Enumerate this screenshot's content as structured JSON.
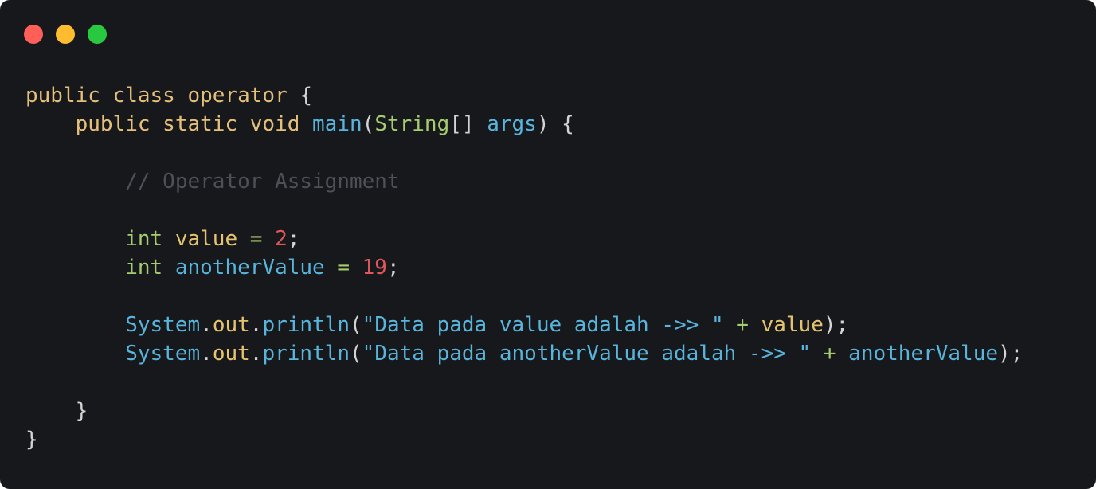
{
  "window": {
    "traffic_lights": [
      {
        "name": "close-dot",
        "color": "#ff5f57"
      },
      {
        "name": "minimize-dot",
        "color": "#febc2e"
      },
      {
        "name": "zoom-dot",
        "color": "#28c840"
      }
    ]
  },
  "colors": {
    "keyword": "#e5c07b",
    "function": "#61afef",
    "type": "#98c379",
    "string": "#56b6c2",
    "number": "#e06c75",
    "comment": "#5c6370",
    "punctuation": "#d4d4d4",
    "variable_yellow": "#e5c07b",
    "variable_blue": "#61afef"
  },
  "code": {
    "lines": [
      [
        {
          "t": "public class operator ",
          "c": "#e5c07b"
        },
        {
          "t": "{",
          "c": "#d4d4d4"
        }
      ],
      [
        {
          "t": "    public static void ",
          "c": "#e5c07b"
        },
        {
          "t": "main",
          "c": "#58b5dd"
        },
        {
          "t": "(",
          "c": "#d4d4d4"
        },
        {
          "t": "String",
          "c": "#a6cc70"
        },
        {
          "t": "[] ",
          "c": "#d4d4d4"
        },
        {
          "t": "args",
          "c": "#58b5dd"
        },
        {
          "t": ") {",
          "c": "#d4d4d4"
        }
      ],
      [],
      [
        {
          "t": "        // Operator Assignment",
          "c": "#4c5158"
        }
      ],
      [],
      [
        {
          "t": "        int ",
          "c": "#a6cc70"
        },
        {
          "t": "value",
          "c": "#e6c46f"
        },
        {
          "t": " = ",
          "c": "#a6cc70"
        },
        {
          "t": "2",
          "c": "#e0575b"
        },
        {
          "t": ";",
          "c": "#d4d4d4"
        }
      ],
      [
        {
          "t": "        int ",
          "c": "#a6cc70"
        },
        {
          "t": "anotherValue",
          "c": "#58b5dd"
        },
        {
          "t": " = ",
          "c": "#a6cc70"
        },
        {
          "t": "19",
          "c": "#e0575b"
        },
        {
          "t": ";",
          "c": "#d4d4d4"
        }
      ],
      [],
      [
        {
          "t": "        System",
          "c": "#58b5dd"
        },
        {
          "t": ".",
          "c": "#d4d4d4"
        },
        {
          "t": "out",
          "c": "#e6c46f"
        },
        {
          "t": ".",
          "c": "#d4d4d4"
        },
        {
          "t": "println",
          "c": "#58b5dd"
        },
        {
          "t": "(",
          "c": "#d4d4d4"
        },
        {
          "t": "\"Data pada value adalah ->> \"",
          "c": "#58b5dd"
        },
        {
          "t": " + ",
          "c": "#a6cc70"
        },
        {
          "t": "value",
          "c": "#e6c46f"
        },
        {
          "t": ");",
          "c": "#d4d4d4"
        }
      ],
      [
        {
          "t": "        System",
          "c": "#58b5dd"
        },
        {
          "t": ".",
          "c": "#d4d4d4"
        },
        {
          "t": "out",
          "c": "#e6c46f"
        },
        {
          "t": ".",
          "c": "#d4d4d4"
        },
        {
          "t": "println",
          "c": "#58b5dd"
        },
        {
          "t": "(",
          "c": "#d4d4d4"
        },
        {
          "t": "\"Data pada anotherValue adalah ->> \"",
          "c": "#58b5dd"
        },
        {
          "t": " + ",
          "c": "#a6cc70"
        },
        {
          "t": "anotherValue",
          "c": "#58b5dd"
        },
        {
          "t": ");",
          "c": "#d4d4d4"
        }
      ],
      [],
      [
        {
          "t": "    }",
          "c": "#d4d4d4"
        }
      ],
      [
        {
          "t": "}",
          "c": "#d4d4d4"
        }
      ]
    ]
  }
}
